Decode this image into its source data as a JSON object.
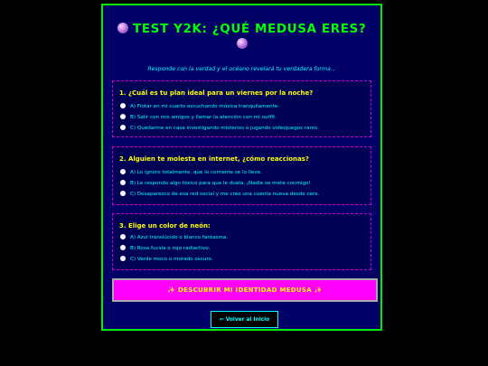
{
  "header": {
    "title": "TEST Y2K: ¿QUÉ MEDUSA ERES?",
    "subtitle": "Responde con la verdad y el océano revelará tu verdadera forma..."
  },
  "questions": [
    {
      "title": "1. ¿Cuál es tu plan ideal para un viernes por la noche?",
      "options": [
        "A) Flotar en mi cuarto escuchando música tranquilamente.",
        "B) Salir con mis amigos y llamar la atención con mi outfit.",
        "C) Quedarme en casa investigando misterios o jugando videojuegos raros."
      ]
    },
    {
      "title": "2. Alguien te molesta en internet, ¿cómo reaccionas?",
      "options": [
        "A) Lo ignoro totalmente, que lo corriente se lo lleve.",
        "B) Le respondo algo tóxico para que le duela. ¡Nadie se mete conmigo!",
        "C) Desaparezco de esa red social y me creo una cuenta nueva desde cero."
      ]
    },
    {
      "title": "3. Elige un color de neón:",
      "options": [
        "A) Azul translúcido o blanco fantasma.",
        "B) Rosa fucsia o rojo radiactivo.",
        "C) Verde moco o morado oscuro."
      ]
    }
  ],
  "actions": {
    "submit_label": "✨ DESCUBRIR MI IDENTIDAD MEDUSA ✨",
    "back_label": "⇐ Volver al Inicio"
  },
  "colors": {
    "page_background": "#000000",
    "panel_background": "#000066",
    "panel_border": "#00ee00",
    "title": "#00ff00",
    "question_title": "#ffff00",
    "option_text": "#00ffff",
    "question_border": "#cc00cc",
    "submit_background": "#ff00ff"
  }
}
